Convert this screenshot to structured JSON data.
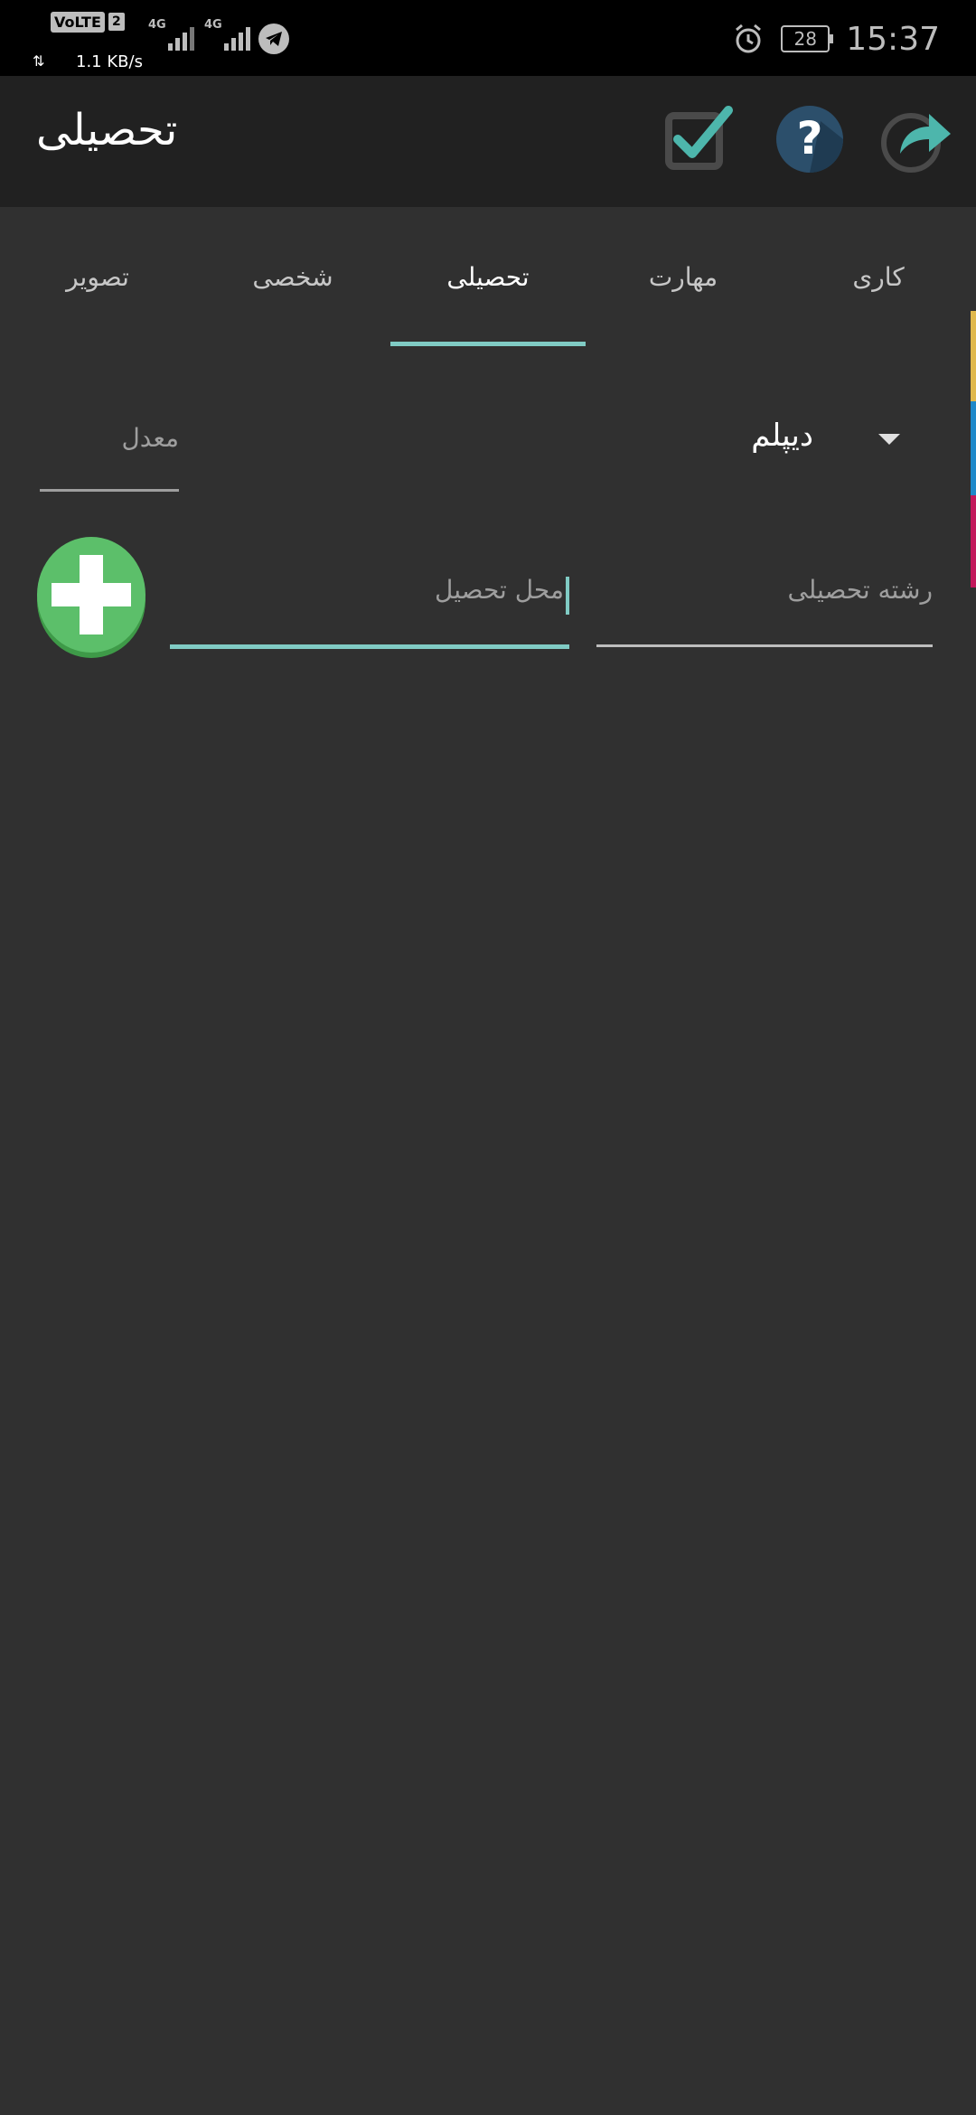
{
  "status_bar": {
    "time": "15:37",
    "battery": "28",
    "network_speed": "1.1 KB/s",
    "volte": "VoLTE",
    "sim": "2",
    "sig1_label": "4G",
    "sig2_label": "4G",
    "icons": [
      "alarm-icon",
      "battery-icon",
      "telegram-icon",
      "signal-icon"
    ]
  },
  "app_bar": {
    "title": "تحصیلی",
    "actions": [
      "share-icon",
      "help-icon",
      "check-icon"
    ]
  },
  "tabs": [
    {
      "label": "کاری",
      "active": false
    },
    {
      "label": "مهارت",
      "active": false
    },
    {
      "label": "تحصیلی",
      "active": true
    },
    {
      "label": "شخصی",
      "active": false
    },
    {
      "label": "تصویر",
      "active": false
    }
  ],
  "form": {
    "degree_value": "دیپلم",
    "average_placeholder": "معدل",
    "major_placeholder": "رشته تحصیلی",
    "place_placeholder": "محل تحصیل"
  },
  "colors": {
    "accent": "#80cbc4",
    "background": "#303030",
    "appbar": "#212121",
    "add_button": "#4caf50",
    "strip": [
      "#e0b84c",
      "#1e88c9",
      "#c2185b"
    ]
  }
}
